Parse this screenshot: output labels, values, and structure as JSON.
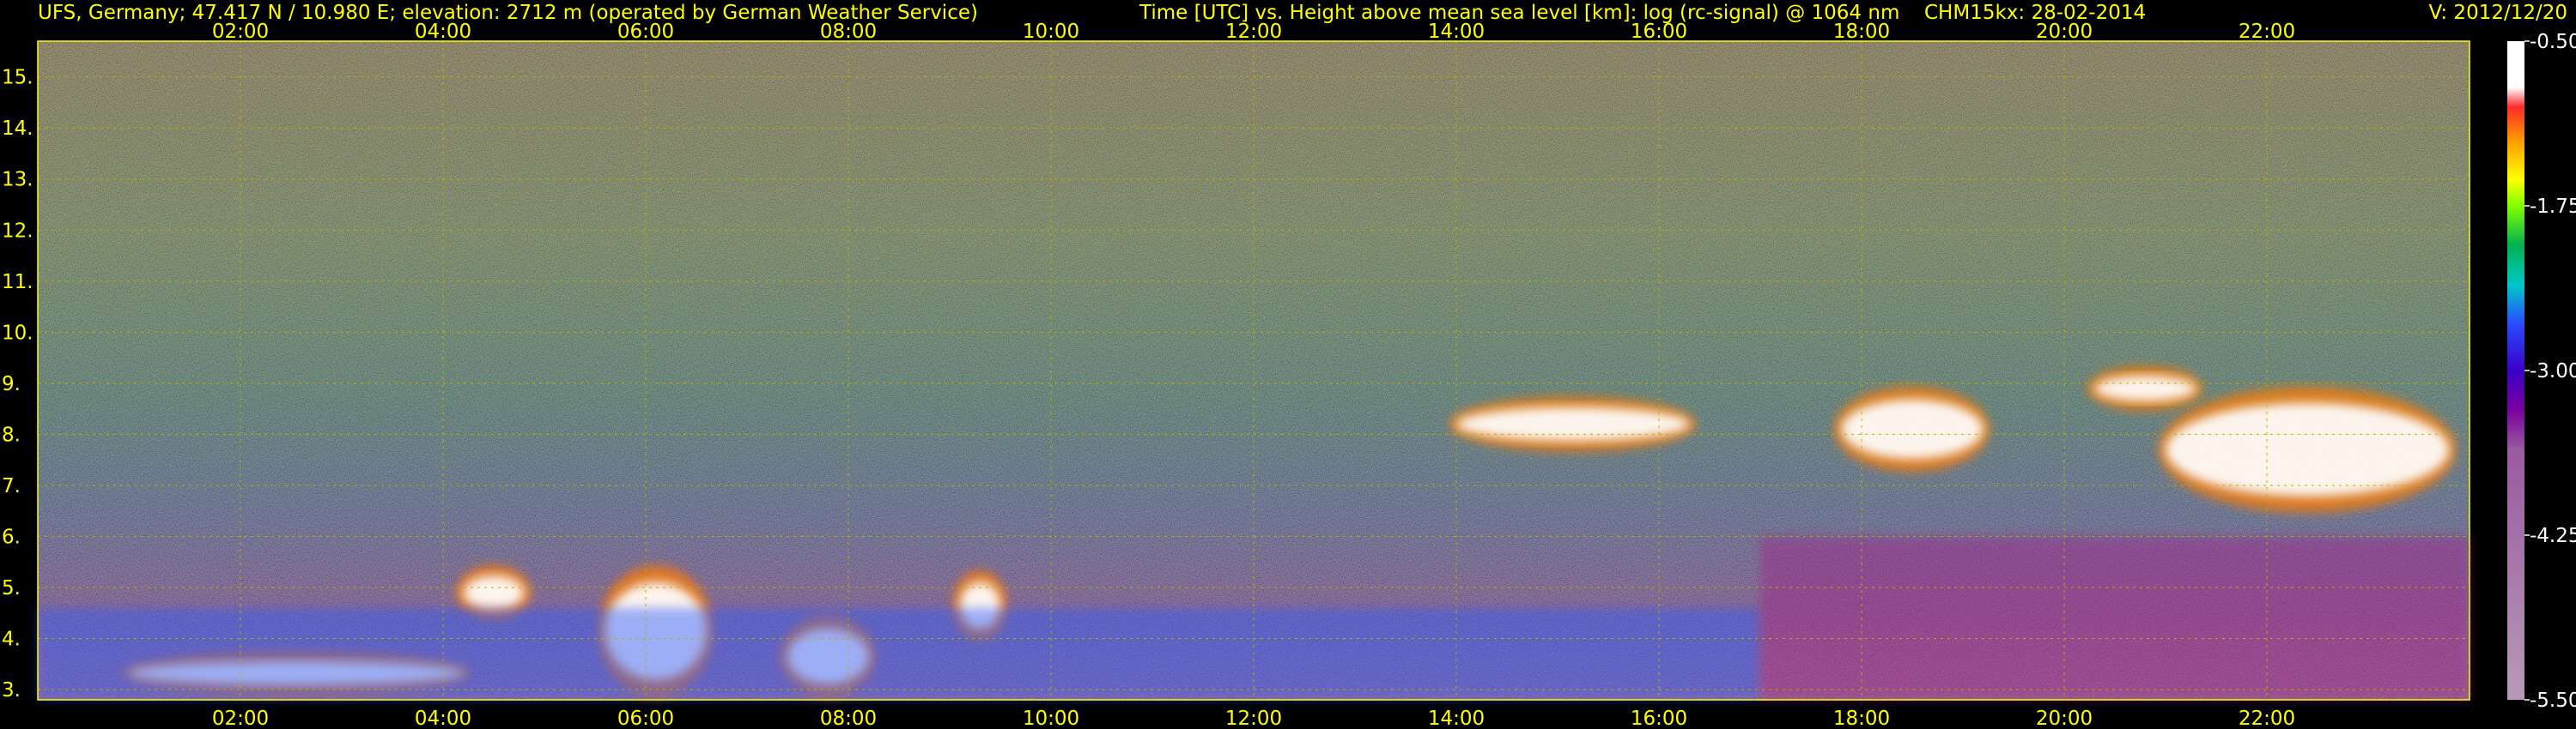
{
  "header": {
    "station": "UFS, Germany; 47.417 N / 10.980 E; elevation: 2712 m  (operated by German Weather Service)",
    "axes": "Time [UTC] vs. Height above mean sea level [km]: log (rc-signal) @ 1064 nm",
    "instrument": "CHM15kx: 28-02-2014",
    "version": "V: 2012/12/20"
  },
  "chart_data": {
    "type": "heatmap",
    "x_range_hours": [
      0,
      24
    ],
    "x_ticks": [
      "02:00",
      "04:00",
      "06:00",
      "08:00",
      "10:00",
      "12:00",
      "14:00",
      "16:00",
      "18:00",
      "20:00",
      "22:00"
    ],
    "y_range_km": [
      2.8,
      15.7
    ],
    "y_ticks": [
      "3.",
      "4.",
      "5.",
      "6.",
      "7.",
      "8.",
      "9.",
      "10.",
      "11.",
      "12.",
      "13.",
      "14.",
      "15."
    ],
    "grid": true,
    "colorbar": {
      "range": [
        -5.5,
        -0.5
      ],
      "ticks": [
        "-0.50",
        "-1.75",
        "-3.00",
        "-4.25",
        "-5.50"
      ]
    },
    "colors": {
      "background": "#000000",
      "labels": "#ffff00",
      "grid": "#b8b000"
    },
    "features": [
      {
        "kind": "cloud",
        "t0": 0.9,
        "t1": 4.2,
        "h0": 3.05,
        "h1": 3.6
      },
      {
        "kind": "cloud",
        "t0": 4.2,
        "t1": 4.8,
        "h0": 4.5,
        "h1": 5.3
      },
      {
        "kind": "cloud",
        "t0": 5.6,
        "t1": 6.6,
        "h0": 3.0,
        "h1": 5.3
      },
      {
        "kind": "cloud",
        "t0": 7.4,
        "t1": 8.2,
        "h0": 3.0,
        "h1": 4.3
      },
      {
        "kind": "cloud",
        "t0": 9.1,
        "t1": 9.5,
        "h0": 4.1,
        "h1": 5.2
      },
      {
        "kind": "cloud",
        "t0": 14.0,
        "t1": 16.3,
        "h0": 7.8,
        "h1": 8.6
      },
      {
        "kind": "cloud",
        "t0": 17.8,
        "t1": 19.2,
        "h0": 7.4,
        "h1": 8.8
      },
      {
        "kind": "cloud",
        "t0": 20.3,
        "t1": 21.3,
        "h0": 8.6,
        "h1": 9.2
      },
      {
        "kind": "cloud",
        "t0": 21.0,
        "t1": 23.8,
        "h0": 6.6,
        "h1": 8.8
      },
      {
        "kind": "boundary_layer",
        "t0": 0,
        "t1": 17.0,
        "h0": 2.8,
        "h1": 4.6
      },
      {
        "kind": "boundary_layer",
        "t0": 17.0,
        "t1": 24,
        "h0": 2.8,
        "h1": 6.0
      }
    ]
  }
}
